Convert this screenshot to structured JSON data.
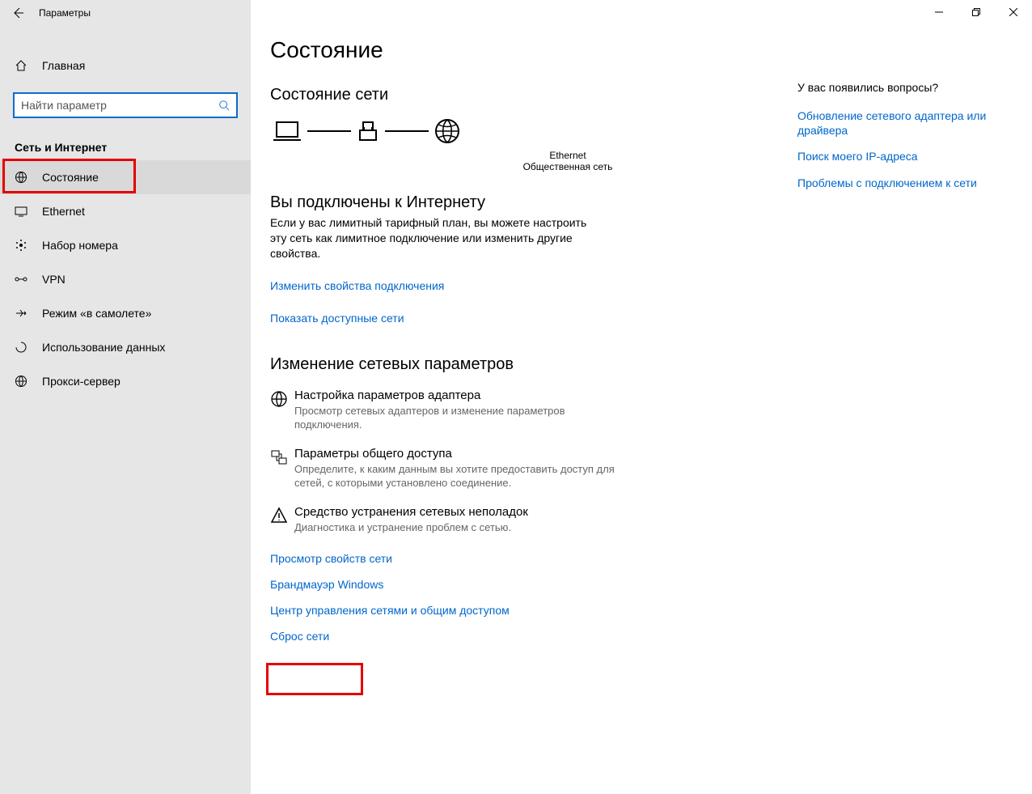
{
  "window_title": "Параметры",
  "home_label": "Главная",
  "search_placeholder": "Найти параметр",
  "category_header": "Сеть и Интернет",
  "nav": [
    {
      "label": "Состояние",
      "icon": "globe",
      "active": true
    },
    {
      "label": "Ethernet",
      "icon": "monitor",
      "active": false
    },
    {
      "label": "Набор номера",
      "icon": "dial",
      "active": false
    },
    {
      "label": "VPN",
      "icon": "vpn",
      "active": false
    },
    {
      "label": "Режим «в самолете»",
      "icon": "airplane",
      "active": false
    },
    {
      "label": "Использование данных",
      "icon": "data",
      "active": false
    },
    {
      "label": "Прокси-сервер",
      "icon": "globe",
      "active": false
    }
  ],
  "page_title": "Состояние",
  "section_status": "Состояние сети",
  "diagram_mid_label": "Ethernet",
  "diagram_mid_sub": "Общественная сеть",
  "connected_title": "Вы подключены к Интернету",
  "connected_desc": "Если у вас лимитный тарифный план, вы можете настроить эту сеть как лимитное подключение или изменить другие свойства.",
  "link_change_props": "Изменить свойства подключения",
  "link_show_networks": "Показать доступные сети",
  "section_change": "Изменение сетевых параметров",
  "options": [
    {
      "icon": "globe",
      "title": "Настройка параметров адаптера",
      "desc": "Просмотр сетевых адаптеров и изменение параметров подключения."
    },
    {
      "icon": "share",
      "title": "Параметры общего доступа",
      "desc": "Определите, к каким данным вы хотите предоставить доступ для сетей, с которыми установлено соединение."
    },
    {
      "icon": "troubleshoot",
      "title": "Средство устранения сетевых неполадок",
      "desc": "Диагностика и устранение проблем с сетью."
    }
  ],
  "bottom_links": [
    "Просмотр свойств сети",
    "Брандмауэр Windows",
    "Центр управления сетями и общим доступом",
    "Сброс сети"
  ],
  "help": {
    "question": "У вас появились вопросы?",
    "links": [
      "Обновление сетевого адаптера или драйвера",
      "Поиск моего IP-адреса",
      "Проблемы с подключением к сети"
    ]
  }
}
